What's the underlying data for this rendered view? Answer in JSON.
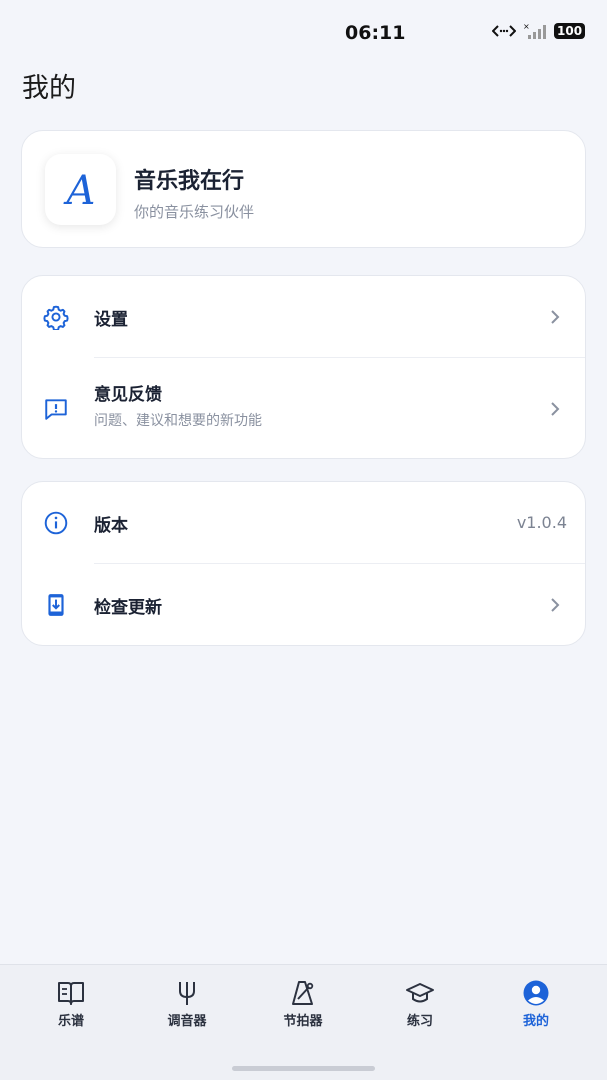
{
  "status_bar": {
    "time": "06:11",
    "battery": "100"
  },
  "page": {
    "title": "我的"
  },
  "profile": {
    "app_name": "音乐我在行",
    "slogan": "你的音乐练习伙伴",
    "logo_letter": "A"
  },
  "menu": {
    "settings_label": "设置",
    "feedback_label": "意见反馈",
    "feedback_sublabel": "问题、建议和想要的新功能",
    "version_label": "版本",
    "version_value": "v1.0.4",
    "update_label": "检查更新"
  },
  "tabs": [
    {
      "label": "乐谱",
      "icon": "book-icon",
      "active": false
    },
    {
      "label": "调音器",
      "icon": "tuning-fork-icon",
      "active": false
    },
    {
      "label": "节拍器",
      "icon": "metronome-icon",
      "active": false
    },
    {
      "label": "练习",
      "icon": "graduation-cap-icon",
      "active": false
    },
    {
      "label": "我的",
      "icon": "user-icon",
      "active": true
    }
  ],
  "colors": {
    "accent": "#1d63d8",
    "background": "#f3f5fa"
  }
}
